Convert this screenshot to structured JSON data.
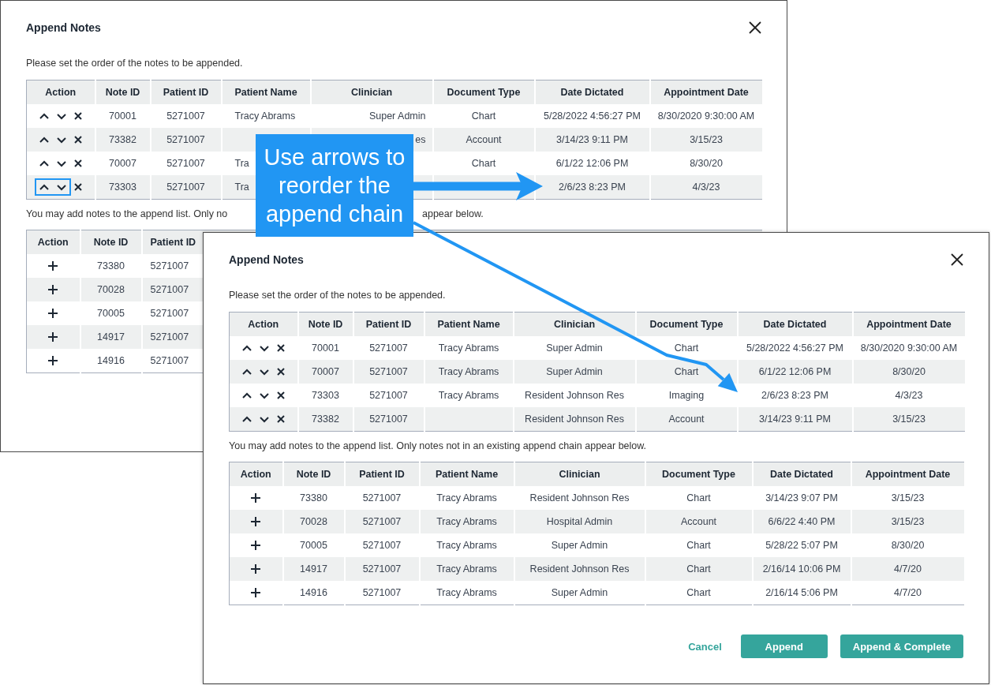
{
  "back_dialog": {
    "title": "Append Notes",
    "instruction": "Please set the order of the notes to be appended.",
    "order_table": {
      "action_column": "Action",
      "columns": [
        "Note ID",
        "Patient ID",
        "Patient Name",
        "Clinician",
        "Document Type",
        "Date Dictated",
        "Appointment Date"
      ],
      "rows": [
        {
          "focused": false,
          "cells": [
            "70001",
            "5271007",
            "Tracy Abrams",
            "Super Admin",
            "Chart",
            "5/28/2022 4:56:27 PM",
            "8/30/2020 9:30:00 AM"
          ]
        },
        {
          "focused": false,
          "cells": [
            "73382",
            "5271007",
            null,
            "es",
            "Account",
            "3/14/23 9:11 PM",
            "3/15/23"
          ]
        },
        {
          "focused": false,
          "cells": [
            "70007",
            "5271007",
            "Tra",
            null,
            "Chart",
            "6/1/22 12:06 PM",
            "8/30/20"
          ]
        },
        {
          "focused": true,
          "cells": [
            "73303",
            "5271007",
            "Tra",
            null,
            null,
            "2/6/23 8:23 PM",
            "4/3/23"
          ]
        }
      ]
    },
    "add_text_start": "You may add notes to the append list. Only no",
    "add_text_end": "appear below.",
    "add_table": {
      "action_column": "Action",
      "columns": [
        "Note ID",
        "Patient ID"
      ],
      "rows": [
        {
          "cells": [
            "73380",
            "5271007"
          ]
        },
        {
          "cells": [
            "70028",
            "5271007"
          ]
        },
        {
          "cells": [
            "70005",
            "5271007"
          ]
        },
        {
          "cells": [
            "14917",
            "5271007"
          ]
        },
        {
          "cells": [
            "14916",
            "5271007"
          ]
        }
      ]
    }
  },
  "front_dialog": {
    "title": "Append Notes",
    "instruction": "Please set the order of the notes to be appended.",
    "order_table": {
      "action_column": "Action",
      "columns": [
        "Note ID",
        "Patient ID",
        "Patient Name",
        "Clinician",
        "Document Type",
        "Date Dictated",
        "Appointment Date"
      ],
      "rows": [
        {
          "focused": false,
          "cells": [
            "70001",
            "5271007",
            "Tracy Abrams",
            "Super Admin",
            "Chart",
            "5/28/2022 4:56:27 PM",
            "8/30/2020 9:30:00 AM"
          ]
        },
        {
          "focused": false,
          "cells": [
            "70007",
            "5271007",
            "Tracy Abrams",
            "Super Admin",
            "Chart",
            "6/1/22 12:06 PM",
            "8/30/20"
          ]
        },
        {
          "focused": false,
          "cells": [
            "73303",
            "5271007",
            "Tracy Abrams",
            "Resident Johnson Res",
            "Imaging",
            "2/6/23 8:23 PM",
            "4/3/23"
          ]
        },
        {
          "focused": false,
          "cells": [
            "73382",
            "5271007",
            null,
            "Resident Johnson Res",
            "Account",
            "3/14/23 9:11 PM",
            "3/15/23"
          ]
        }
      ]
    },
    "add_text": "You may add notes to the append list. Only notes not in an existing append chain appear below.",
    "add_table": {
      "action_column": "Action",
      "columns": [
        "Note ID",
        "Patient ID",
        "Patient Name",
        "Clinician",
        "Document Type",
        "Date Dictated",
        "Appointment Date"
      ],
      "rows": [
        {
          "cells": [
            "73380",
            "5271007",
            "Tracy Abrams",
            "Resident Johnson Res",
            "Chart",
            "3/14/23 9:07 PM",
            "3/15/23"
          ]
        },
        {
          "cells": [
            "70028",
            "5271007",
            "Tracy Abrams",
            "Hospital Admin",
            "Account",
            "6/6/22 4:40 PM",
            "3/15/23"
          ]
        },
        {
          "cells": [
            "70005",
            "5271007",
            "Tracy Abrams",
            "Super Admin",
            "Chart",
            "5/28/22 5:07 PM",
            "8/30/20"
          ]
        },
        {
          "cells": [
            "14917",
            "5271007",
            "Tracy Abrams",
            "Resident Johnson Res",
            "Chart",
            "2/16/14 10:06 PM",
            "4/7/20"
          ]
        },
        {
          "cells": [
            "14916",
            "5271007",
            "Tracy Abrams",
            "Super Admin",
            "Chart",
            "2/16/14 5:06 PM",
            "4/7/20"
          ]
        }
      ]
    },
    "buttons": [
      {
        "label": "Cancel",
        "kind": "link"
      },
      {
        "label": "Append",
        "kind": "primary"
      },
      {
        "label": "Append & Complete",
        "kind": "primary"
      }
    ]
  },
  "callout": {
    "text": "Use arrows to reorder the append chain"
  }
}
